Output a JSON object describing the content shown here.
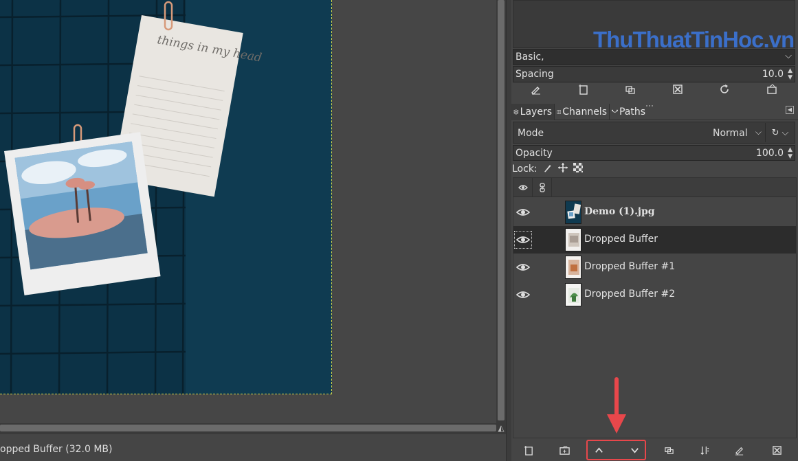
{
  "status": {
    "text": "opped Buffer (32.0 MB)"
  },
  "canvas": {
    "image_note_text": "things in my head"
  },
  "watermark": {
    "text": "ThuThuatTinHoc.vn",
    "color": "#3b6fc9"
  },
  "brush": {
    "preset_value": "Basic,",
    "spacing_label": "Spacing",
    "spacing_value": "10.0",
    "actions": [
      "edit-brush-icon",
      "new-brush-icon",
      "duplicate-brush-icon",
      "delete-brush-icon",
      "refresh-brushes-icon",
      "open-brush-folder-icon"
    ]
  },
  "tabs": {
    "layers": "Layers",
    "channels": "Channels",
    "paths": "Paths"
  },
  "layers_panel": {
    "mode_label": "Mode",
    "mode_value": "Normal",
    "opacity_label": "Opacity",
    "opacity_value": "100.0",
    "lock_label": "Lock:",
    "layers": [
      {
        "name": "Demo (1).jpg",
        "visible": true,
        "selected": false
      },
      {
        "name": "Dropped Buffer",
        "visible": true,
        "selected": true
      },
      {
        "name": "Dropped Buffer #1",
        "visible": true,
        "selected": false
      },
      {
        "name": "Dropped Buffer #2",
        "visible": true,
        "selected": false
      }
    ]
  },
  "bottom_actions": [
    "new-layer-icon",
    "new-layer-group-icon",
    "raise-layer-icon",
    "lower-layer-icon",
    "duplicate-layer-icon",
    "anchor-layer-icon",
    "merge-down-icon",
    "delete-layer-icon"
  ],
  "annotation": {
    "highlight_color": "#e8474b"
  }
}
